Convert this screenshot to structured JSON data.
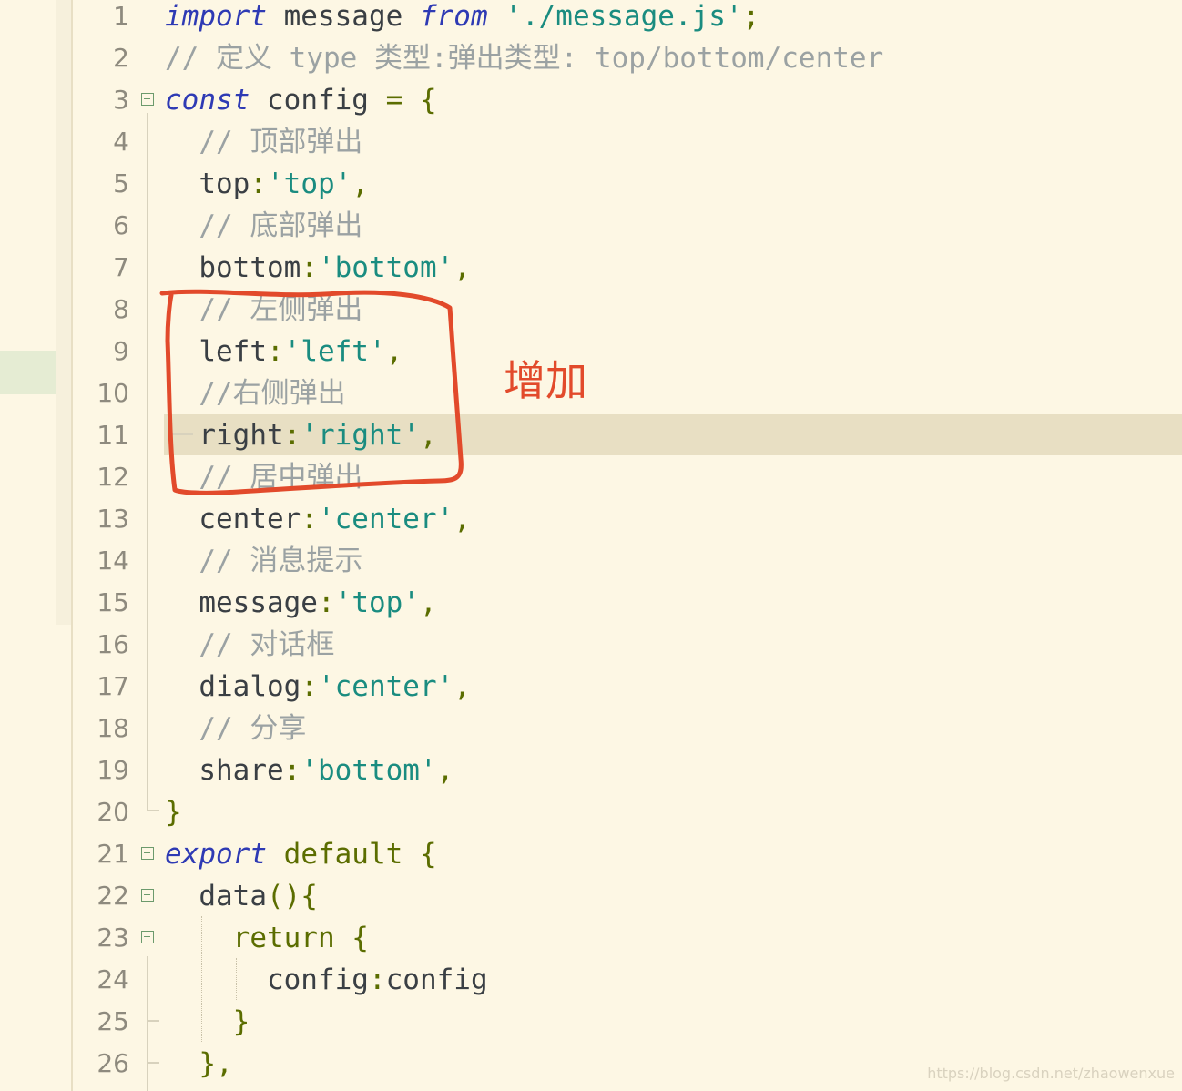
{
  "editor": {
    "lines": [
      {
        "num": "1",
        "parts": [
          [
            "kw",
            "import"
          ],
          [
            "pl",
            " message "
          ],
          [
            "kw",
            "from"
          ],
          [
            "pl",
            " "
          ],
          [
            "str",
            "'./message.js'"
          ],
          [
            "br",
            ";"
          ]
        ]
      },
      {
        "num": "2",
        "parts": [
          [
            "cm",
            "// 定义 type 类型:弹出类型: top/bottom/center"
          ]
        ]
      },
      {
        "num": "3",
        "fold": true,
        "parts": [
          [
            "kw",
            "const"
          ],
          [
            "pl",
            " config "
          ],
          [
            "br",
            "= {"
          ]
        ]
      },
      {
        "num": "4",
        "parts": [
          [
            "pl",
            "  "
          ],
          [
            "cm",
            "// 顶部弹出"
          ]
        ]
      },
      {
        "num": "5",
        "parts": [
          [
            "pl",
            "  top"
          ],
          [
            "br",
            ":"
          ],
          [
            "str",
            "'top'"
          ],
          [
            "br",
            ","
          ]
        ]
      },
      {
        "num": "6",
        "parts": [
          [
            "pl",
            "  "
          ],
          [
            "cm",
            "// 底部弹出"
          ]
        ]
      },
      {
        "num": "7",
        "parts": [
          [
            "pl",
            "  bottom"
          ],
          [
            "br",
            ":"
          ],
          [
            "str",
            "'bottom'"
          ],
          [
            "br",
            ","
          ]
        ]
      },
      {
        "num": "8",
        "parts": [
          [
            "pl",
            "  "
          ],
          [
            "cm",
            "// 左侧弹出"
          ]
        ]
      },
      {
        "num": "9",
        "parts": [
          [
            "pl",
            "  left"
          ],
          [
            "br",
            ":"
          ],
          [
            "str",
            "'left'"
          ],
          [
            "br",
            ","
          ]
        ]
      },
      {
        "num": "10",
        "parts": [
          [
            "pl",
            "  "
          ],
          [
            "cm",
            "//右侧弹出"
          ]
        ]
      },
      {
        "num": "11",
        "parts": [
          [
            "pl",
            "  right"
          ],
          [
            "br",
            ":"
          ],
          [
            "str",
            "'right'"
          ],
          [
            "br",
            ","
          ]
        ]
      },
      {
        "num": "12",
        "parts": [
          [
            "pl",
            "  "
          ],
          [
            "cm",
            "// 居中弹出"
          ]
        ]
      },
      {
        "num": "13",
        "parts": [
          [
            "pl",
            "  center"
          ],
          [
            "br",
            ":"
          ],
          [
            "str",
            "'center'"
          ],
          [
            "br",
            ","
          ]
        ]
      },
      {
        "num": "14",
        "parts": [
          [
            "pl",
            "  "
          ],
          [
            "cm",
            "// 消息提示"
          ]
        ]
      },
      {
        "num": "15",
        "parts": [
          [
            "pl",
            "  message"
          ],
          [
            "br",
            ":"
          ],
          [
            "str",
            "'top'"
          ],
          [
            "br",
            ","
          ]
        ]
      },
      {
        "num": "16",
        "parts": [
          [
            "pl",
            "  "
          ],
          [
            "cm",
            "// 对话框"
          ]
        ]
      },
      {
        "num": "17",
        "parts": [
          [
            "pl",
            "  dialog"
          ],
          [
            "br",
            ":"
          ],
          [
            "str",
            "'center'"
          ],
          [
            "br",
            ","
          ]
        ]
      },
      {
        "num": "18",
        "parts": [
          [
            "pl",
            "  "
          ],
          [
            "cm",
            "// 分享"
          ]
        ]
      },
      {
        "num": "19",
        "parts": [
          [
            "pl",
            "  share"
          ],
          [
            "br",
            ":"
          ],
          [
            "str",
            "'bottom'"
          ],
          [
            "br",
            ","
          ]
        ]
      },
      {
        "num": "20",
        "parts": [
          [
            "br",
            "}"
          ]
        ]
      },
      {
        "num": "21",
        "fold": true,
        "parts": [
          [
            "kw",
            "export"
          ],
          [
            "pl",
            " "
          ],
          [
            "fn",
            "default {"
          ]
        ]
      },
      {
        "num": "22",
        "fold": true,
        "parts": [
          [
            "pl",
            "  data"
          ],
          [
            "br",
            "(){"
          ]
        ]
      },
      {
        "num": "23",
        "fold": true,
        "parts": [
          [
            "pl",
            "    "
          ],
          [
            "ret",
            "return {"
          ]
        ]
      },
      {
        "num": "24",
        "parts": [
          [
            "pl",
            "      config"
          ],
          [
            "br",
            ":"
          ],
          [
            "pl",
            "config"
          ]
        ]
      },
      {
        "num": "25",
        "parts": [
          [
            "pl",
            "    "
          ],
          [
            "br",
            "}"
          ]
        ]
      },
      {
        "num": "26",
        "parts": [
          [
            "pl",
            "  "
          ],
          [
            "br",
            "},"
          ]
        ]
      }
    ],
    "current_line": "11"
  },
  "annotation": {
    "label": "增加",
    "color": "#e24a2b"
  },
  "watermark": "https://blog.csdn.net/zhaowenxue"
}
